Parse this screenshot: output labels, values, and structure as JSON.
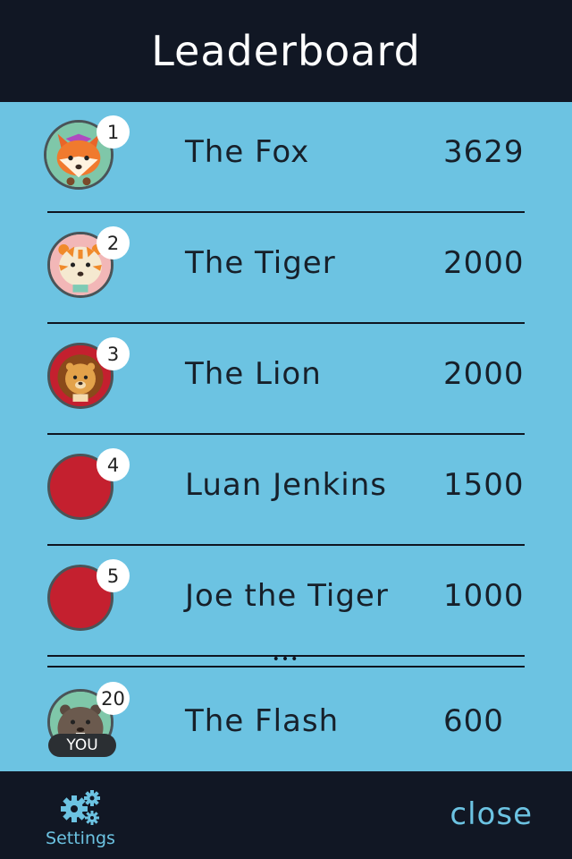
{
  "header": {
    "title": "Leaderboard"
  },
  "leaderboard": {
    "entries": [
      {
        "rank": "1",
        "name": "The Fox",
        "score": "3629",
        "avatar": "fox-avatar",
        "avatar_color": "#7fc7a9"
      },
      {
        "rank": "2",
        "name": "The Tiger",
        "score": "2000",
        "avatar": "tiger-avatar",
        "avatar_color": "#f2b7b7"
      },
      {
        "rank": "3",
        "name": "The Lion",
        "score": "2000",
        "avatar": "lion-avatar",
        "avatar_color": "#c4202f"
      },
      {
        "rank": "4",
        "name": "Luan Jenkins",
        "score": "1500",
        "avatar": "blank-avatar",
        "avatar_color": "#c4202f"
      },
      {
        "rank": "5",
        "name": "Joe the Tiger",
        "score": "1000",
        "avatar": "blank-avatar",
        "avatar_color": "#c4202f"
      }
    ],
    "separator": "•••",
    "current_user": {
      "rank": "20",
      "name": "The Flash",
      "score": "600",
      "badge": "YOU",
      "avatar": "beaver-avatar",
      "avatar_color": "#7fc7a9"
    }
  },
  "footer": {
    "settings_label": "Settings",
    "settings_icon": "gears-icon",
    "close_label": "close"
  },
  "colors": {
    "background": "#6cc3e2",
    "bars": "#111724",
    "accent": "#6cc3e2",
    "avatar_red": "#c4202f"
  }
}
